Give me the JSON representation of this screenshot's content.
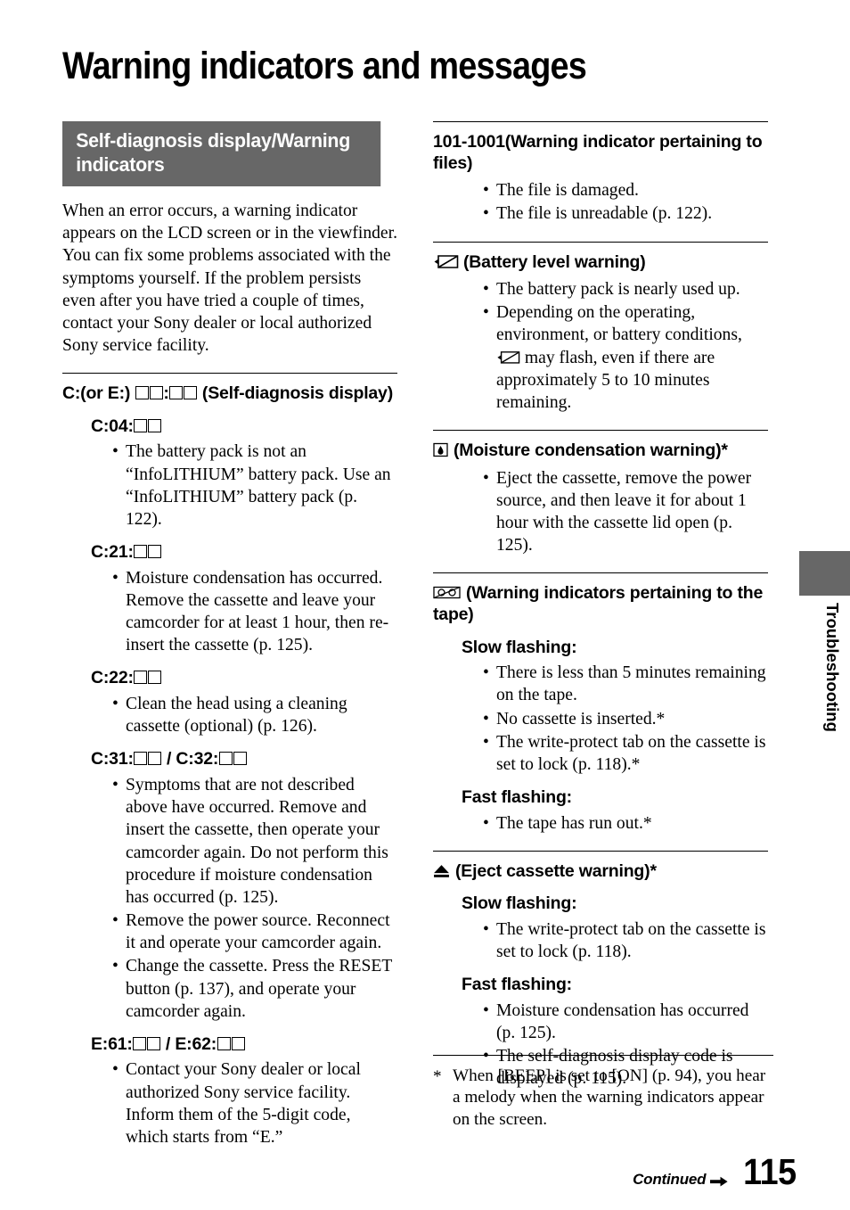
{
  "page": {
    "title": "Warning indicators and messages",
    "number": "115",
    "continued_label": "Continued",
    "side_tab_label": "Troubleshooting",
    "accent_gray": "#676767"
  },
  "left_column": {
    "section_header": "Self-diagnosis display/Warning indicators",
    "intro_paragraphs": [
      "When an error occurs, a warning indicator appears on the LCD screen or in the viewfinder.",
      "You can fix some problems associated with the symptoms yourself. If the problem persists even after you have tried a couple of times, contact your Sony dealer or local authorized Sony service facility."
    ],
    "heading": {
      "prefix": "C:(or E:) ",
      "suffix": " (Self-diagnosis display)"
    },
    "subsections": [
      {
        "code_prefix": "C:04:",
        "code_suffix": "",
        "bullets": [
          "The battery pack is not an “InfoLITHIUM” battery pack. Use an “InfoLITHIUM” battery pack (p. 122)."
        ]
      },
      {
        "code_prefix": "C:21:",
        "code_suffix": "",
        "bullets": [
          "Moisture condensation has occurred. Remove the cassette and leave your camcorder for at least 1 hour, then re-insert the cassette (p. 125)."
        ]
      },
      {
        "code_prefix": "C:22:",
        "code_suffix": "",
        "bullets": [
          "Clean the head using a cleaning cassette (optional) (p. 126)."
        ]
      },
      {
        "code_prefix": "C:31:",
        "code_mid": " / C:32:",
        "code_suffix": "",
        "bullets": [
          "Symptoms that are not described above have occurred. Remove and insert the cassette, then operate your camcorder again. Do not perform this procedure if moisture condensation has occurred (p. 125).",
          "Remove the power source. Reconnect it and operate your camcorder again.",
          "Change the cassette. Press the RESET button (p. 137), and operate your camcorder again."
        ]
      },
      {
        "code_prefix": "E:61:",
        "code_mid": " / E:62:",
        "code_suffix": "",
        "bullets": [
          "Contact your Sony dealer or local authorized Sony service facility. Inform them of the 5-digit code, which starts from “E.”"
        ]
      }
    ]
  },
  "right_column": {
    "sections": [
      {
        "id": "files",
        "heading": "101-1001(Warning indicator pertaining to files)",
        "bullets": [
          "The file is damaged.",
          "The file is unreadable (p. 122)."
        ]
      },
      {
        "id": "battery",
        "icon": "battery-low-icon",
        "heading": "(Battery level warning)",
        "bullets_rich": [
          {
            "pre": "The battery pack is nearly used up.",
            "icon": null,
            "post": ""
          },
          {
            "pre": "Depending on the operating, environment, or battery conditions, ",
            "icon": "battery-low-icon",
            "post": " may flash, even if there are approximately 5 to 10 minutes remaining."
          }
        ]
      },
      {
        "id": "moisture",
        "icon": "moisture-drop-icon",
        "heading": "(Moisture condensation warning)*",
        "bullets": [
          "Eject the cassette, remove the power source, and then leave it for about 1 hour with the cassette lid open (p. 125)."
        ]
      },
      {
        "id": "tape",
        "icon": "cassette-tape-warning-icon",
        "heading": "(Warning indicators pertaining to the tape)",
        "groups": [
          {
            "label": "Slow flashing:",
            "bullets": [
              "There is less than 5 minutes remaining on the tape.",
              "No cassette is inserted.*",
              "The write-protect tab on the cassette is set to lock (p. 118).*"
            ]
          },
          {
            "label": "Fast flashing:",
            "bullets": [
              "The tape has run out.*"
            ]
          }
        ]
      },
      {
        "id": "eject",
        "icon": "eject-icon",
        "heading": "(Eject cassette warning)*",
        "groups": [
          {
            "label": "Slow flashing:",
            "bullets": [
              "The write-protect tab on the cassette is set to lock (p. 118)."
            ]
          },
          {
            "label": "Fast flashing:",
            "bullets": [
              "Moisture condensation has occurred (p. 125).",
              "The self-diagnosis display code is displayed (p. 115)."
            ]
          }
        ]
      }
    ],
    "footnote": {
      "marker": "*",
      "text": "When [BEEP] is set to [ON] (p. 94), you hear a melody when the warning indicators appear on the screen."
    }
  }
}
